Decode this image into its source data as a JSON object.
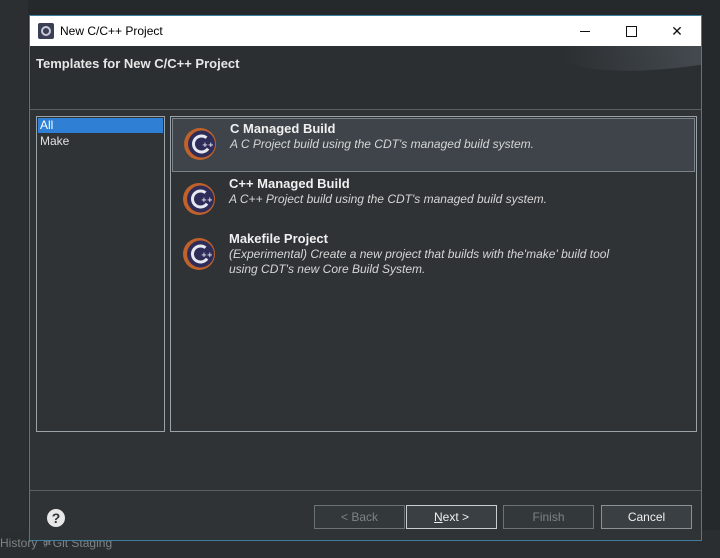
{
  "window": {
    "title": "New C/C++ Project"
  },
  "banner": {
    "title": "Templates for New C/C++ Project"
  },
  "categories": [
    {
      "label": "All",
      "selected": true
    },
    {
      "label": "Make",
      "selected": false
    }
  ],
  "templates": [
    {
      "name": "C Managed Build",
      "description_lines": [
        "A C Project build using the CDT's managed build system."
      ],
      "selected": true
    },
    {
      "name": "C++ Managed Build",
      "description_lines": [
        "A C++ Project build using the CDT's managed build system."
      ],
      "selected": false
    },
    {
      "name": "Makefile Project",
      "description_lines": [
        "(Experimental) Create a new project that builds with the'make' build tool",
        "using CDT's new Core Build System."
      ],
      "selected": false
    }
  ],
  "buttons": {
    "back": "< Back",
    "next_mnemonic": "N",
    "next_rest": "ext >",
    "finish": "Finish",
    "cancel": "Cancel"
  },
  "background_tabs": {
    "history": "History",
    "git_prefix": "git",
    "git_staging": "Git Staging"
  },
  "colors": {
    "accent_selection": "#2f7fd4",
    "icon_ring": "#c0622a",
    "icon_disc": "#2e2c58"
  }
}
